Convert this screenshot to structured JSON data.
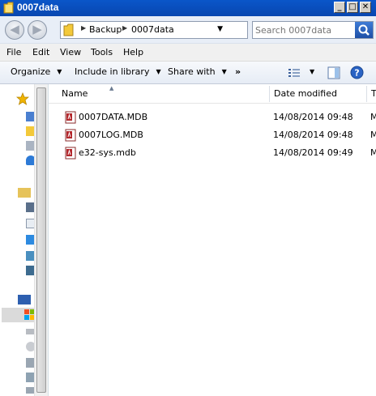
{
  "window": {
    "title": "0007data",
    "minimize_label": "_",
    "maximize_label": "□",
    "close_label": "✕"
  },
  "address": {
    "crumbs": [
      "Backup",
      "0007data"
    ],
    "back_glyph": "◀",
    "forward_glyph": "▶",
    "refresh_glyph": "⟳"
  },
  "search": {
    "placeholder": "Search 0007data"
  },
  "menu": {
    "items": [
      "File",
      "Edit",
      "View",
      "Tools",
      "Help"
    ]
  },
  "commands": {
    "organize": "Organize",
    "include_in_library": "Include in library",
    "share_with": "Share with",
    "more": "»"
  },
  "columns": {
    "name": "Name",
    "date_modified": "Date modified",
    "type_partial": "T"
  },
  "files": [
    {
      "name": "0007DATA.MDB",
      "date": "14/08/2014 09:48",
      "type_partial": "M"
    },
    {
      "name": "0007LOG.MDB",
      "date": "14/08/2014 09:48",
      "type_partial": "M"
    },
    {
      "name": "e32-sys.mdb",
      "date": "14/08/2014 09:49",
      "type_partial": "M"
    }
  ],
  "colors": {
    "titlebar": "#0a56c9",
    "address_bg": "#e8eef7",
    "help_blue": "#2a63c4",
    "star": "#f0b400"
  }
}
